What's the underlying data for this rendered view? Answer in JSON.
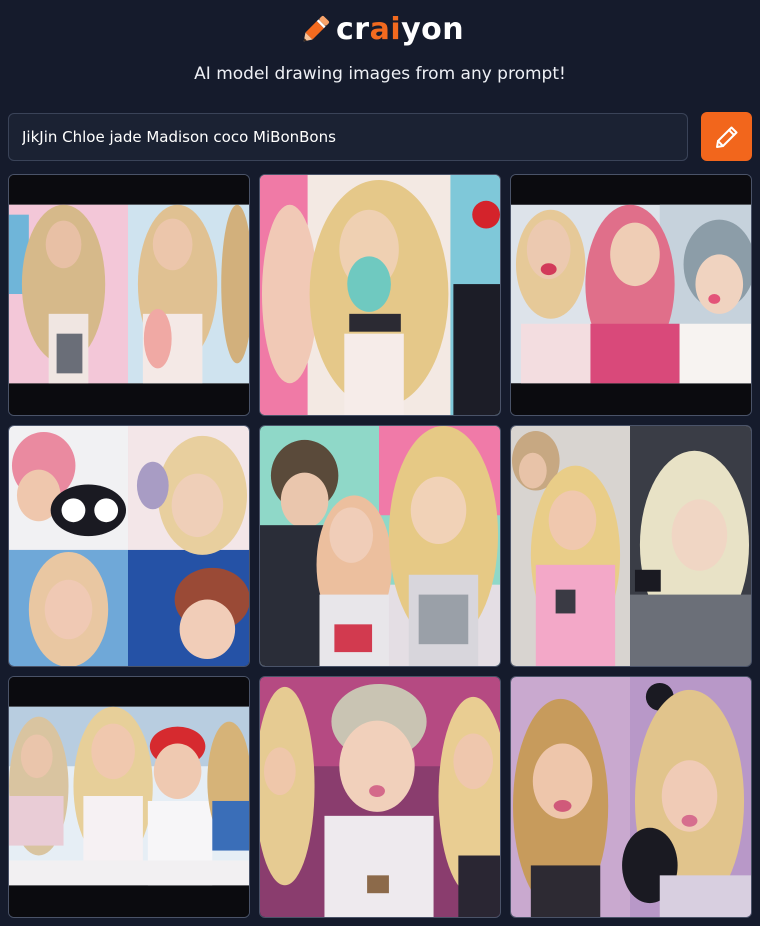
{
  "header": {
    "logo_prefix": "cr",
    "logo_accent": "ai",
    "logo_suffix": "yon",
    "tagline": "AI model drawing images from any prompt!"
  },
  "prompt": {
    "value": "JikJin Chloe jade Madison coco MiBonBons",
    "button_icon": "pencil-icon"
  },
  "colors": {
    "background": "#151b2c",
    "accent": "#f26a1f",
    "input_border": "#3a4358"
  },
  "results": {
    "count": 9
  }
}
